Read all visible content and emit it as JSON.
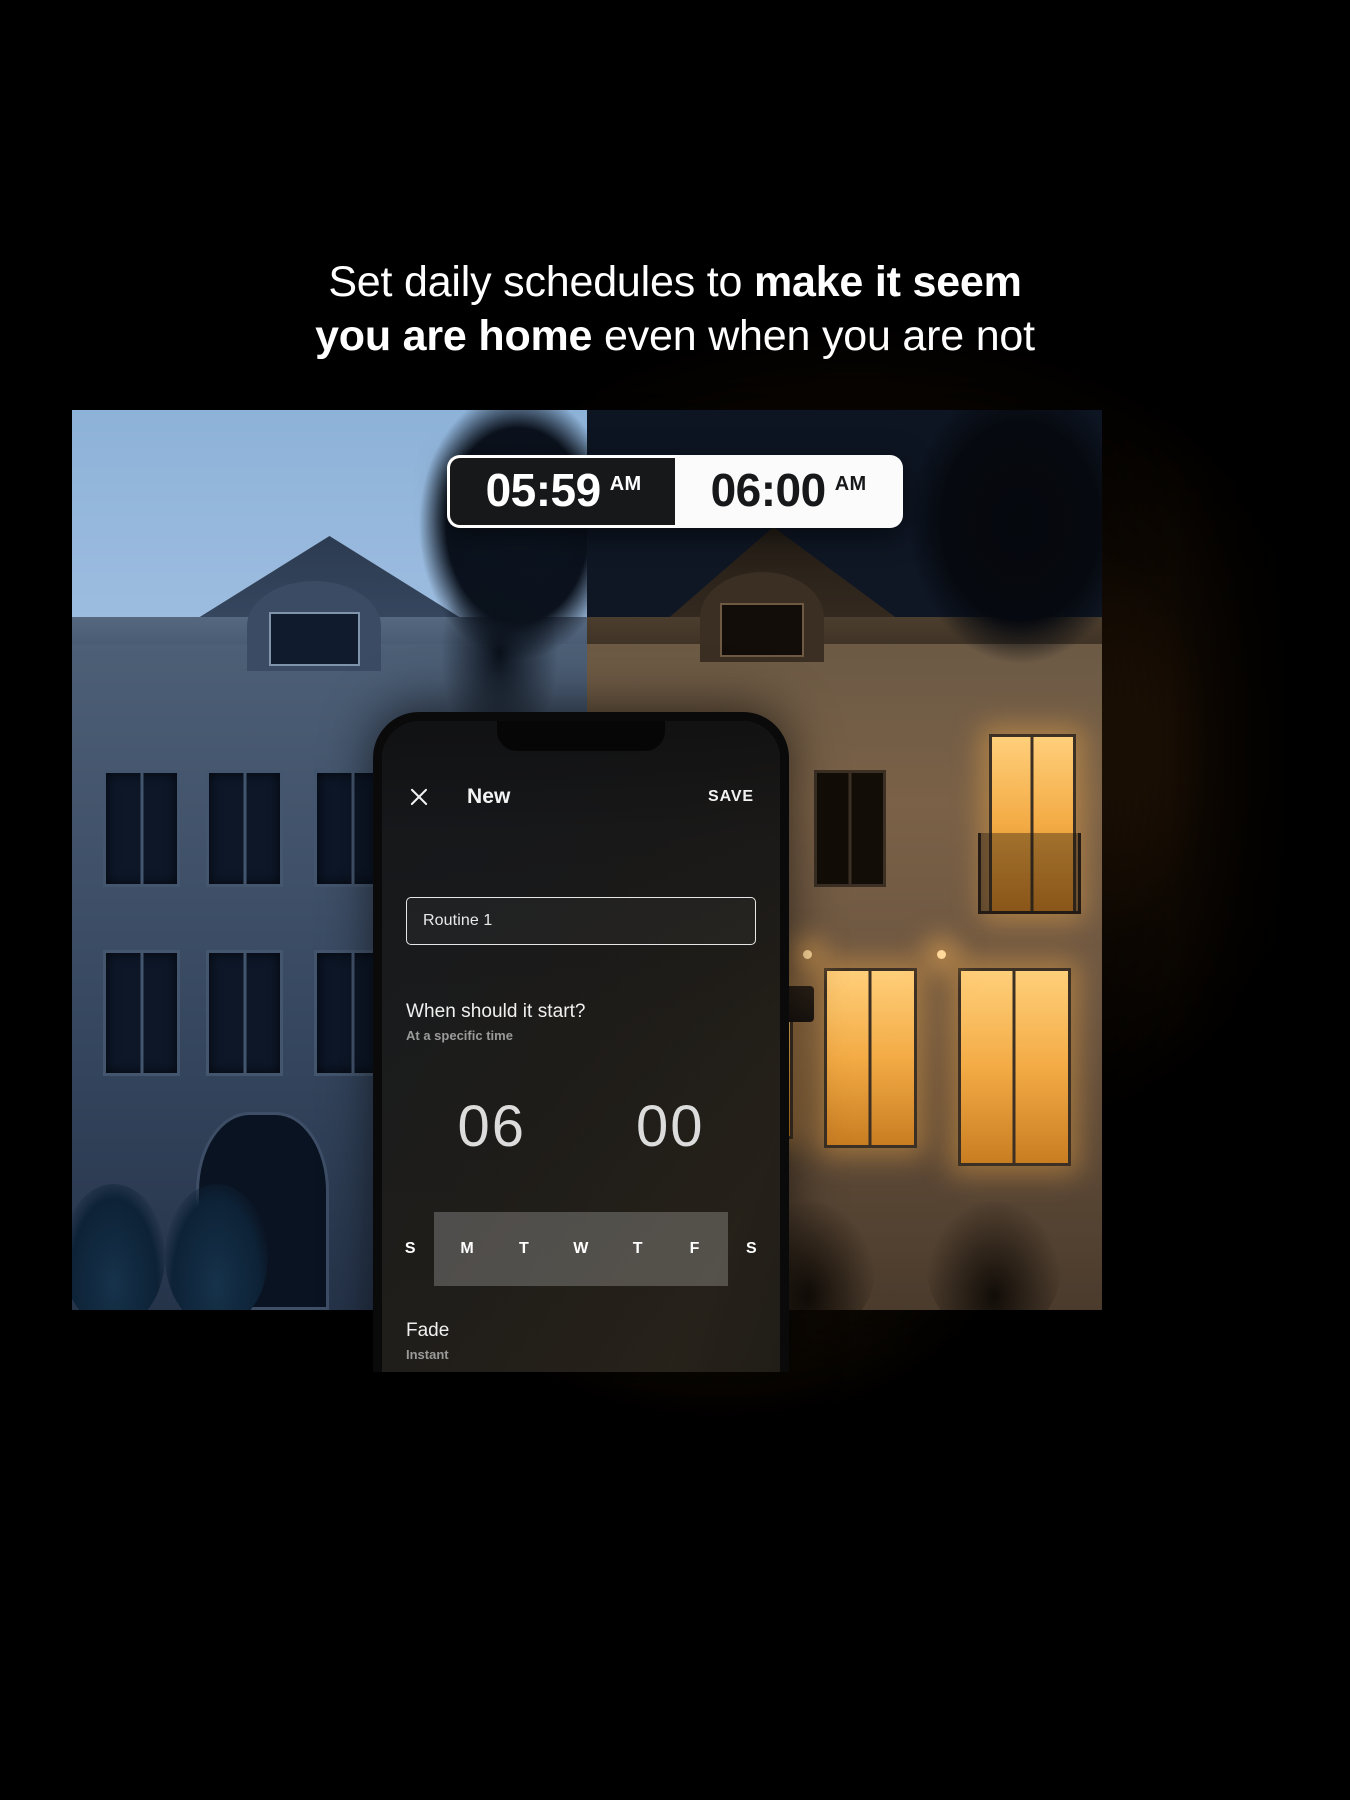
{
  "headline": {
    "line1_regular": "Set daily schedules to ",
    "line1_bold": "make it seem",
    "line2_bold": "you are home",
    "line2_regular": " even when you are not"
  },
  "time_badges": {
    "before": {
      "time": "05:59",
      "meridiem": "AM"
    },
    "after": {
      "time": "06:00",
      "meridiem": "AM"
    }
  },
  "phone": {
    "header": {
      "close_label": "Close",
      "title": "New",
      "save_label": "SAVE"
    },
    "name_field": {
      "value": "Routine 1",
      "placeholder": "Routine 1"
    },
    "start_section": {
      "label": "When should it start?",
      "sub": "At a specific time"
    },
    "time_picker": {
      "hours": "06",
      "minutes": "00"
    },
    "days": [
      {
        "label": "S",
        "selected": false
      },
      {
        "label": "M",
        "selected": true
      },
      {
        "label": "T",
        "selected": true
      },
      {
        "label": "W",
        "selected": true
      },
      {
        "label": "T",
        "selected": true
      },
      {
        "label": "F",
        "selected": true
      },
      {
        "label": "S",
        "selected": false
      }
    ],
    "fade_section": {
      "label": "Fade",
      "sub": "Instant"
    }
  },
  "colors": {
    "background": "#000000",
    "glow": "#a86826",
    "badge_dark_bg": "#17181a",
    "badge_light_bg": "#fbfbfb",
    "text_primary": "#ffffff",
    "text_muted": "#9a9a9a"
  }
}
